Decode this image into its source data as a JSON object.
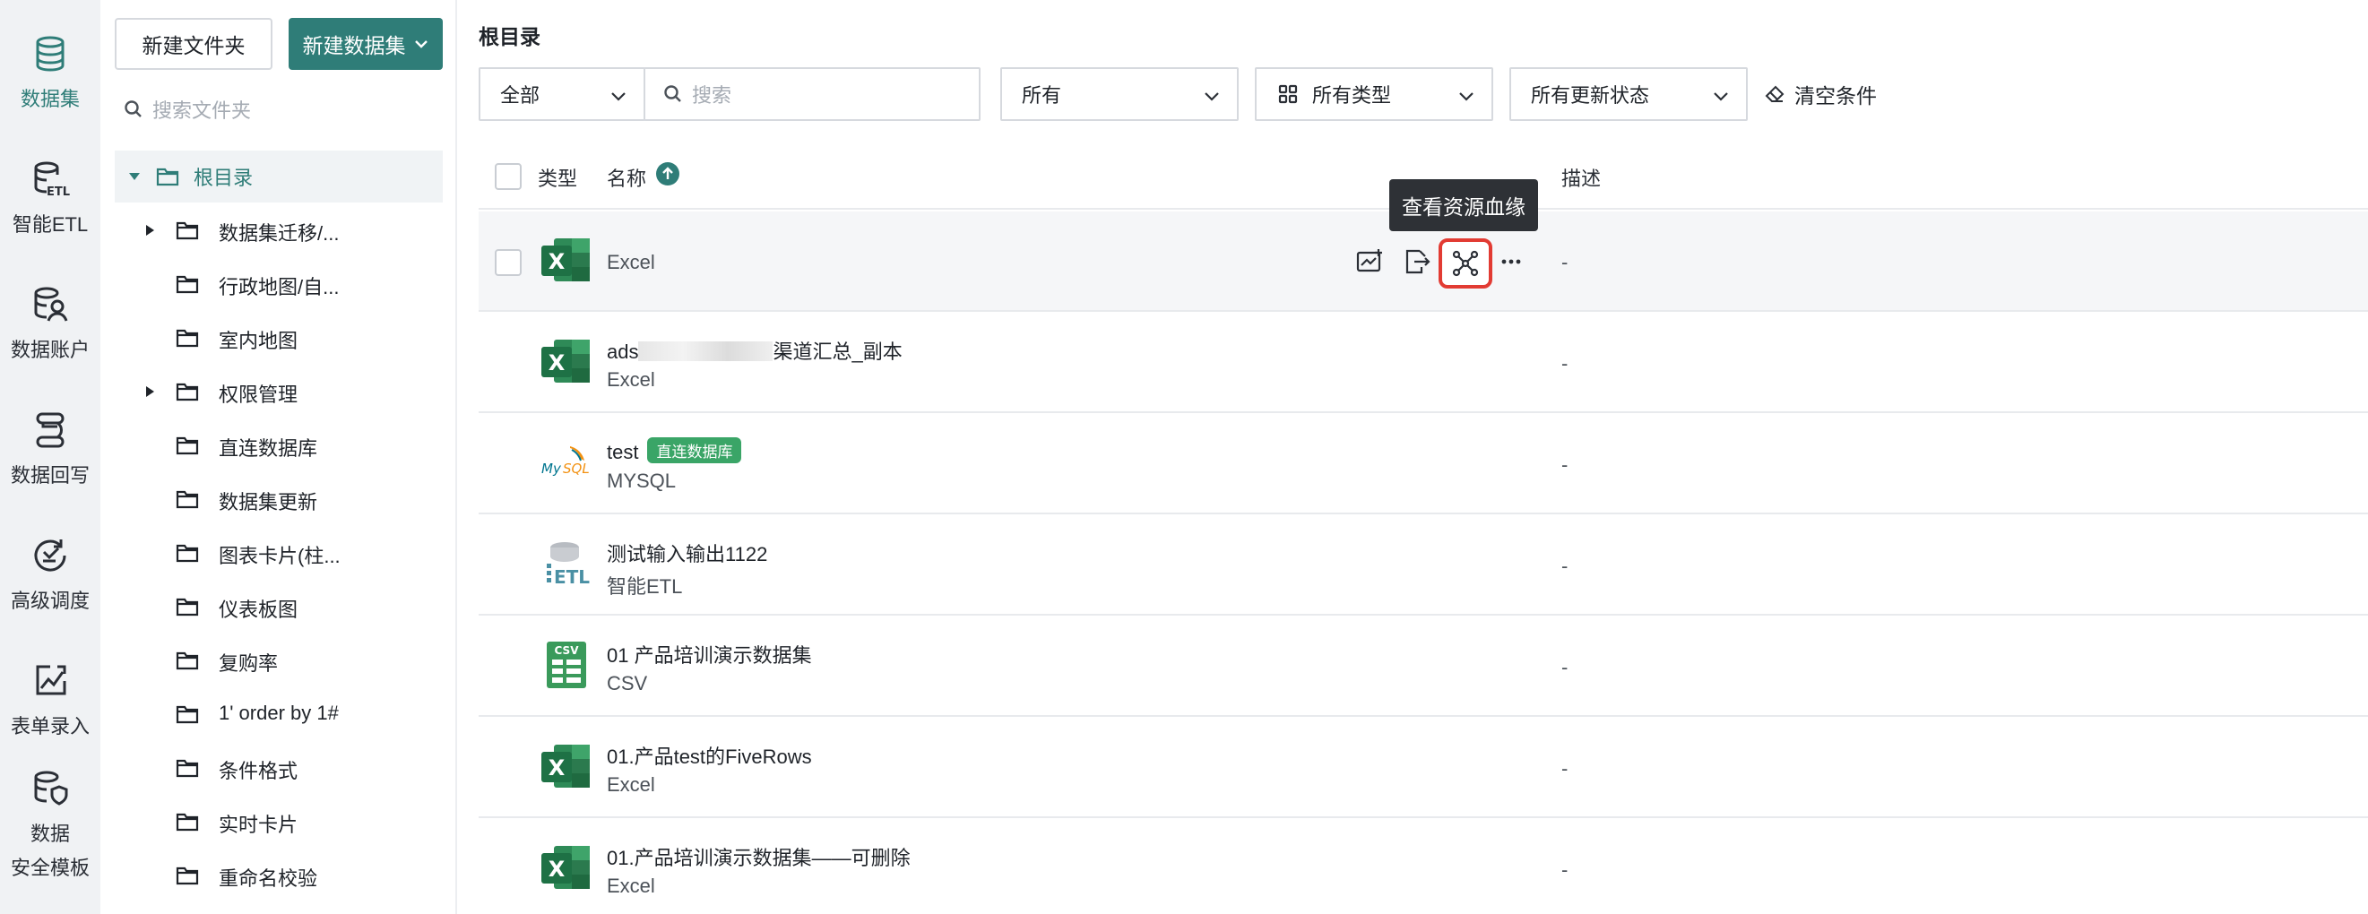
{
  "colors": {
    "brand": "#2f7d78",
    "excel": "#1e7145",
    "csv": "#3a9a5b",
    "highlight": "#e23b33",
    "badge": "#3aa567"
  },
  "rail": [
    {
      "label": "数据集",
      "icon": "database-icon",
      "active": true
    },
    {
      "label": "智能ETL",
      "icon": "etl-icon"
    },
    {
      "label": "数据账户",
      "icon": "data-account-icon"
    },
    {
      "label": "数据回写",
      "icon": "writeback-icon"
    },
    {
      "label": "高级调度",
      "icon": "schedule-icon"
    },
    {
      "label": "表单录入",
      "icon": "form-entry-icon"
    },
    {
      "label": "数据\n安全模板",
      "label_line1": "数据",
      "label_line2": "安全模板",
      "icon": "security-template-icon"
    }
  ],
  "tree": {
    "new_folder": "新建文件夹",
    "new_dataset": "新建数据集",
    "search_placeholder": "搜索文件夹",
    "root": "根目录",
    "items": [
      {
        "label": "数据集迁移/...",
        "expandable": true
      },
      {
        "label": "行政地图/自..."
      },
      {
        "label": "室内地图"
      },
      {
        "label": "权限管理",
        "expandable": true
      },
      {
        "label": "直连数据库"
      },
      {
        "label": "数据集更新"
      },
      {
        "label": "图表卡片(柱..."
      },
      {
        "label": "仪表板图"
      },
      {
        "label": "复购率"
      },
      {
        "label": "1' order by 1#"
      },
      {
        "label": "条件格式"
      },
      {
        "label": "实时卡片"
      },
      {
        "label": "重命名校验"
      }
    ]
  },
  "main": {
    "title": "根目录",
    "filters": {
      "scope": "全部",
      "search_placeholder": "搜索",
      "owner": "所有",
      "type": "所有类型",
      "update_status": "所有更新状态",
      "clear": "清空条件"
    },
    "columns": {
      "type": "类型",
      "name": "名称",
      "desc": "描述"
    },
    "tooltip": "查看资源血缘",
    "rows": [
      {
        "icon": "excel-icon",
        "name": "",
        "sub": "Excel",
        "desc": "-",
        "hover": true
      },
      {
        "icon": "excel-icon",
        "name_prefix": "ads",
        "name_suffix": "渠道汇总_副本",
        "sub": "Excel",
        "desc": "-"
      },
      {
        "icon": "mysql-icon",
        "name": "test",
        "badge": "直连数据库",
        "sub": "MYSQL",
        "desc": "-"
      },
      {
        "icon": "etl-file-icon",
        "name": "测试输入输出1122",
        "sub": "智能ETL",
        "desc": "-"
      },
      {
        "icon": "csv-icon",
        "name": "01 产品培训演示数据集",
        "sub": "CSV",
        "desc": "-"
      },
      {
        "icon": "excel-icon",
        "name": "01.产品test的FiveRows",
        "sub": "Excel",
        "desc": "-"
      },
      {
        "icon": "excel-icon",
        "name": "01.产品培训演示数据集——可删除",
        "sub": "Excel",
        "desc": "-"
      }
    ]
  }
}
